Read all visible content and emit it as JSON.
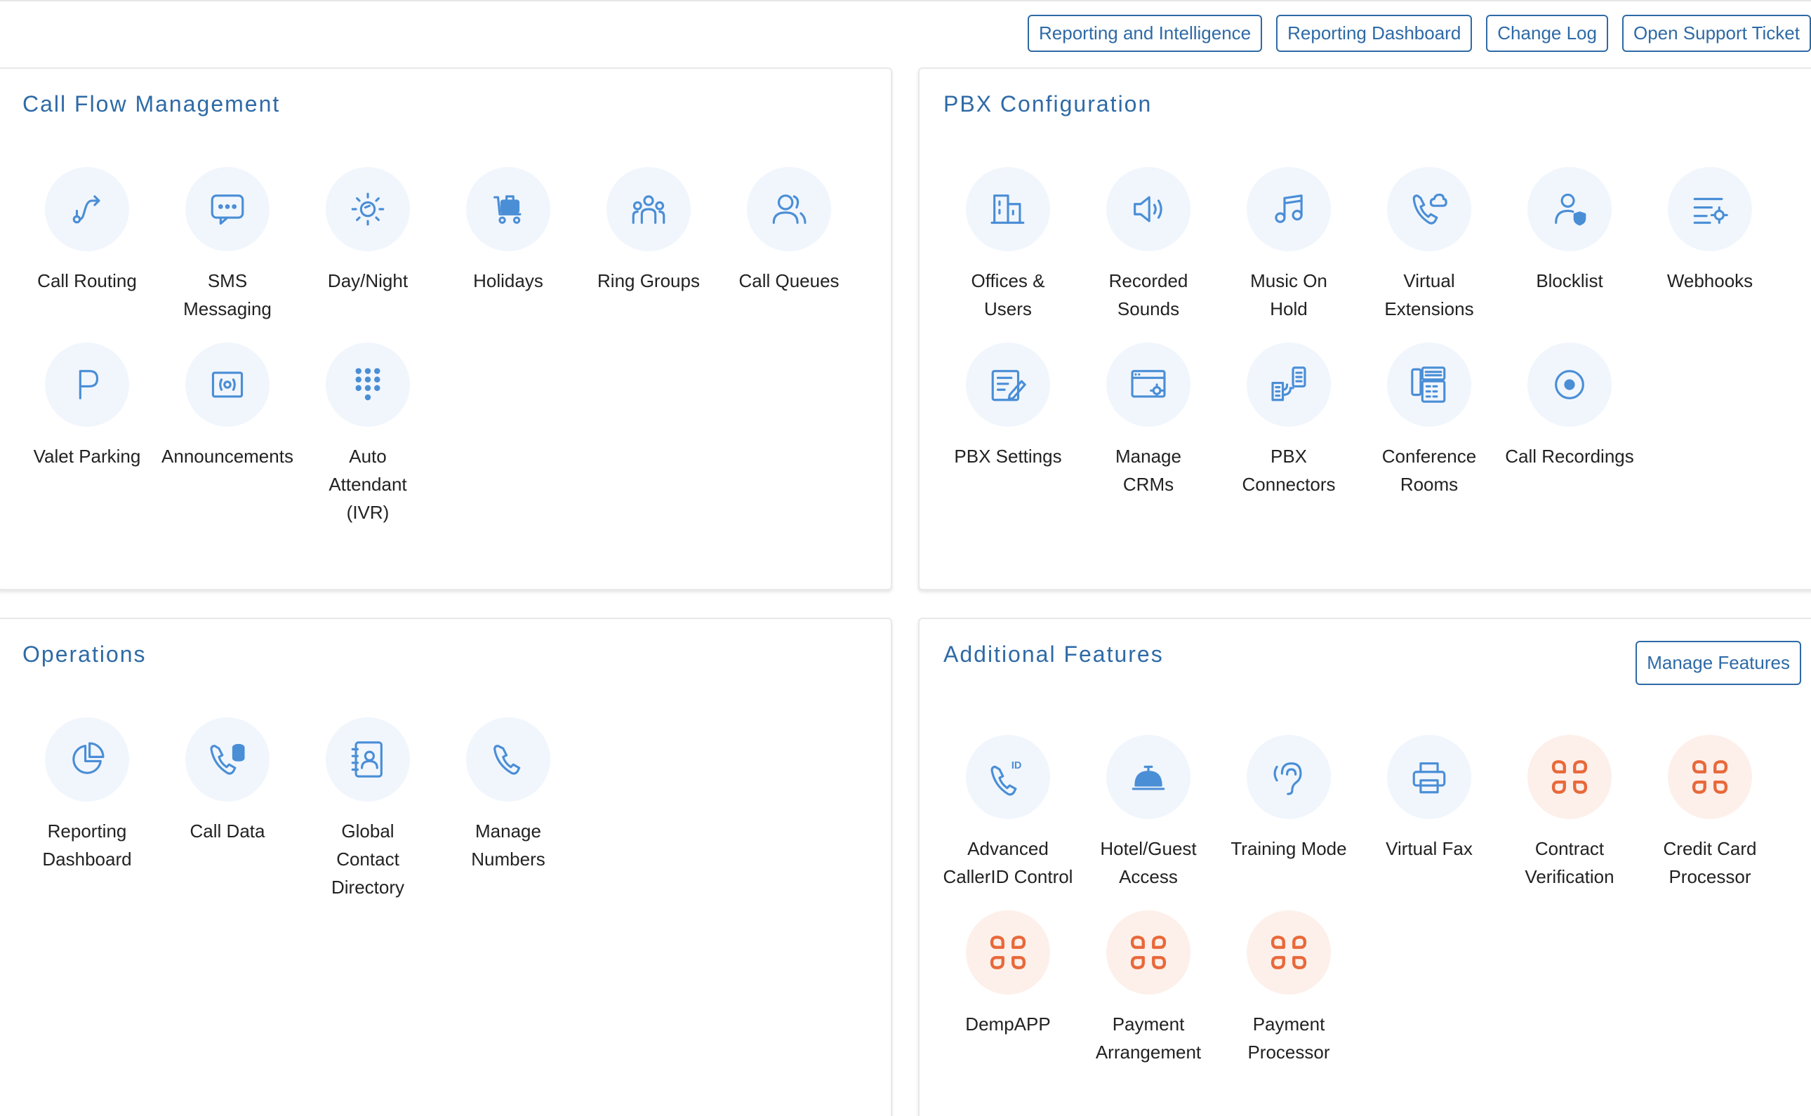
{
  "top_buttons": [
    "Reporting and Intelligence",
    "Reporting Dashboard",
    "Change Log",
    "Open Support Ticket"
  ],
  "call_flow": {
    "title": "Call Flow Management",
    "items": [
      "Call Routing",
      "SMS\nMessaging",
      "Day/Night",
      "Holidays",
      "Ring Groups",
      "Call Queues",
      "Valet Parking",
      "Announcements",
      "Auto\nAttendant\n(IVR)"
    ]
  },
  "pbx": {
    "title": "PBX Configuration",
    "items": [
      "Offices &\nUsers",
      "Recorded\nSounds",
      "Music On\nHold",
      "Virtual\nExtensions",
      "Blocklist",
      "Webhooks",
      "PBX Settings",
      "Manage\nCRMs",
      "PBX\nConnectors",
      "Conference\nRooms",
      "Call Recordings"
    ]
  },
  "operations": {
    "title": "Operations",
    "items": [
      "Reporting\nDashboard",
      "Call Data",
      "Global\nContact\nDirectory",
      "Manage\nNumbers"
    ]
  },
  "additional": {
    "title": "Additional Features",
    "manage_label": "Manage Features",
    "items": [
      "Advanced\nCallerID Control",
      "Hotel/Guest\nAccess",
      "Training Mode",
      "Virtual Fax",
      "Contract\nVerification",
      "Credit Card\nProcessor",
      "DempAPP",
      "Payment\nArrangement",
      "Payment\nProcessor"
    ]
  },
  "colors": {
    "accent": "#2e6aa6",
    "icon_blue": "#4a8ed6",
    "icon_bg_blue": "#f1f6fd",
    "icon_orange": "#e8683a",
    "icon_bg_orange": "#fdf0ea"
  },
  "icons": {
    "call_flow": [
      "route-icon",
      "sms-icon",
      "day-night-icon",
      "holidays-icon",
      "ring-groups-icon",
      "call-queues-icon",
      "parking-icon",
      "announcements-icon",
      "dialpad-icon"
    ],
    "pbx": [
      "offices-icon",
      "speaker-icon",
      "music-icon",
      "cloud-phone-icon",
      "blocklist-icon",
      "webhooks-icon",
      "settings-form-icon",
      "crm-icon",
      "connectors-icon",
      "conference-icon",
      "record-icon"
    ],
    "operations": [
      "pie-chart-icon",
      "call-data-icon",
      "contact-book-icon",
      "phone-icon"
    ],
    "additional": [
      "caller-id-icon",
      "bell-icon",
      "ear-icon",
      "fax-icon",
      "app-icon",
      "app-icon",
      "app-icon",
      "app-icon",
      "app-icon"
    ]
  }
}
